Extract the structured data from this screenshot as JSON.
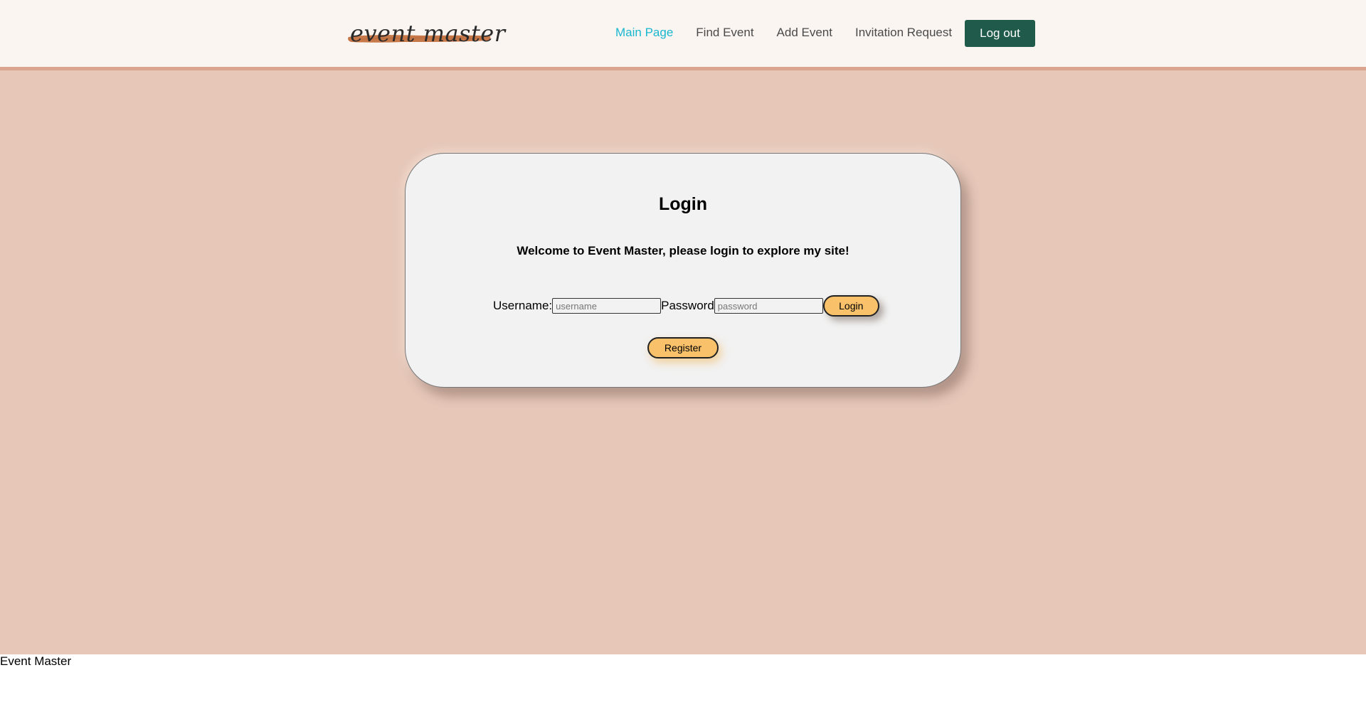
{
  "header": {
    "logo_text": "event master",
    "nav": [
      {
        "label": "Main Page",
        "active": true
      },
      {
        "label": "Find Event",
        "active": false
      },
      {
        "label": "Add Event",
        "active": false
      },
      {
        "label": "Invitation Request",
        "active": false
      }
    ],
    "logout_label": "Log out"
  },
  "login": {
    "title": "Login",
    "welcome": "Welcome to Event Master, please login to explore my site!",
    "username_label": "Username:",
    "username_placeholder": "username",
    "username_value": "",
    "password_label": "Password",
    "password_placeholder": "password",
    "password_value": "",
    "login_button": "Login",
    "register_button": "Register"
  },
  "footer": {
    "text": "Event Master"
  },
  "colors": {
    "nav_bg": "#fbf5f2",
    "nav_active": "#19b7cf",
    "logout_bg": "#1f5a4a",
    "page_bg": "#e6c7b8",
    "card_bg": "#f2f2f2",
    "button_bg": "#f8c16a",
    "logo_brush": "#c8794a"
  }
}
